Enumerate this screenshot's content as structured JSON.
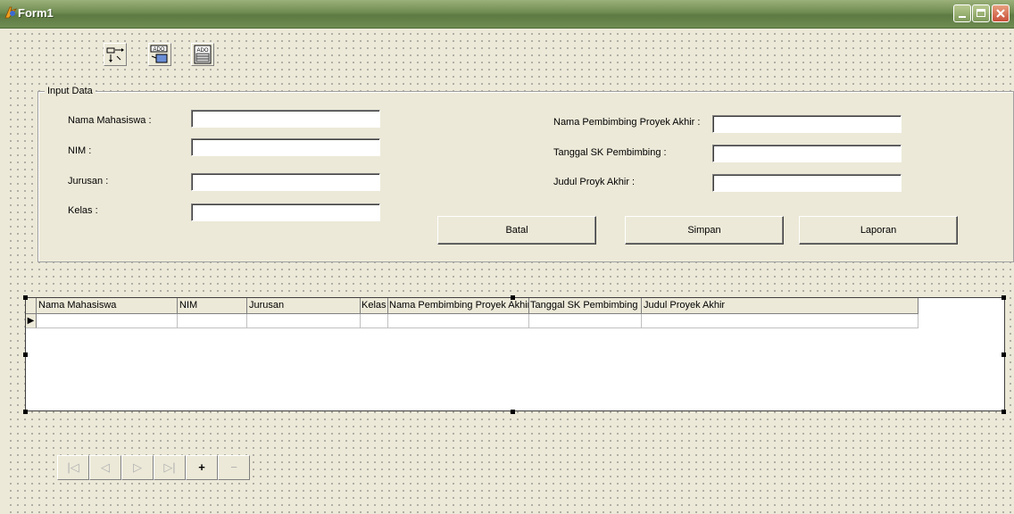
{
  "window": {
    "title": "Form1",
    "title_color": "#ffffff",
    "titlebar_color": "#6f8c52"
  },
  "toolbar_components": [
    {
      "icon": "data-movement-icon"
    },
    {
      "icon": "ado-connection-icon",
      "caption": "ADO"
    },
    {
      "icon": "ado-table-icon",
      "caption": "ADO"
    }
  ],
  "input_group": {
    "title": "Input Data",
    "left_fields": [
      {
        "label": "Nama Mahasiswa :",
        "value": ""
      },
      {
        "label": "NIM :",
        "value": ""
      },
      {
        "label": "Jurusan :",
        "value": ""
      },
      {
        "label": "Kelas :",
        "value": ""
      }
    ],
    "right_fields": [
      {
        "label": "Nama Pembimbing Proyek Akhir :",
        "value": ""
      },
      {
        "label": "Tanggal SK Pembimbing :",
        "value": ""
      },
      {
        "label": "Judul Proyk Akhir :",
        "value": ""
      }
    ],
    "buttons": {
      "batal": "Batal",
      "simpan": "Simpan",
      "laporan": "Laporan"
    }
  },
  "grid": {
    "columns": [
      "Nama Mahasiswa",
      "NIM",
      "Jurusan",
      "Kelas",
      "Nama Pembimbing Proyek Akhir",
      "Tanggal SK Pembimbing",
      "Judul Proyek Akhir"
    ],
    "row_indicator": "▶"
  },
  "navigator": {
    "buttons": [
      {
        "name": "first",
        "symbol": "|◁",
        "enabled": false
      },
      {
        "name": "prior",
        "symbol": "◁",
        "enabled": false
      },
      {
        "name": "next",
        "symbol": "▷",
        "enabled": false
      },
      {
        "name": "last",
        "symbol": "▷|",
        "enabled": false
      },
      {
        "name": "insert",
        "symbol": "+",
        "enabled": true
      },
      {
        "name": "delete",
        "symbol": "−",
        "enabled": false
      }
    ]
  }
}
